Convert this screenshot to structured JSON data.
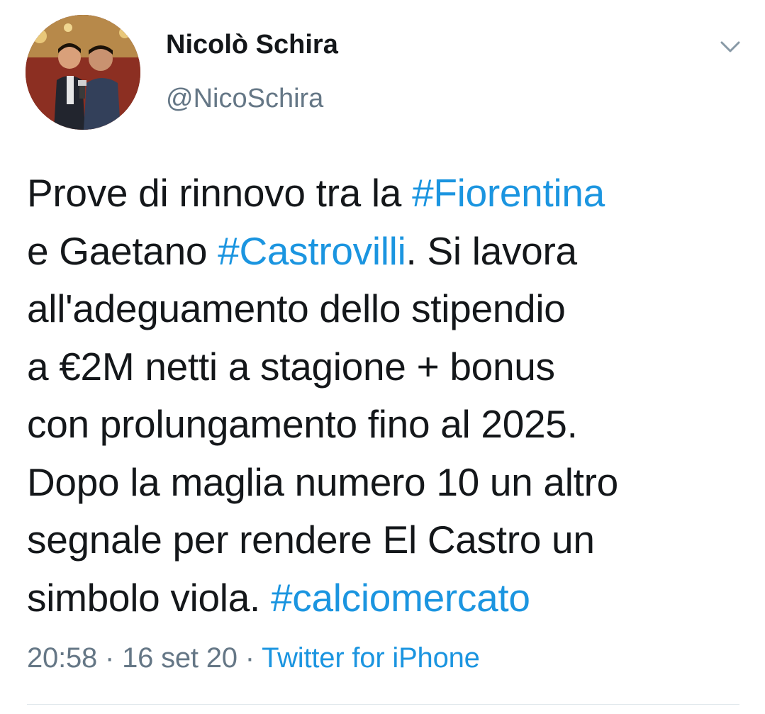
{
  "author": {
    "display_name": "Nicolò Schira",
    "handle": "@NicoSchira"
  },
  "tweet": {
    "lines": [
      [
        {
          "text": "Prove di rinnovo tra la "
        },
        {
          "text": "#Fiorentina",
          "hashtag": true
        }
      ],
      [
        {
          "text": "e Gaetano "
        },
        {
          "text": "#Castrovilli",
          "hashtag": true
        },
        {
          "text": ". Si lavora"
        }
      ],
      [
        {
          "text": "all'adeguamento dello stipendio"
        }
      ],
      [
        {
          "text": "a €2M netti a stagione + bonus"
        }
      ],
      [
        {
          "text": "con prolungamento fino al 2025."
        }
      ],
      [
        {
          "text": "Dopo la maglia numero 10 un altro"
        }
      ],
      [
        {
          "text": "segnale per rendere El Castro un"
        }
      ],
      [
        {
          "text": "simbolo viola. "
        },
        {
          "text": "#calciomercato",
          "hashtag": true
        }
      ]
    ]
  },
  "meta": {
    "time": "20:58",
    "separator": " · ",
    "date": "16 set 20",
    "source": "Twitter for iPhone"
  },
  "icons": {
    "caret": "chevron-down-icon",
    "avatar": "profile-photo"
  },
  "colors": {
    "text": "#14171a",
    "secondary": "#657786",
    "link": "#1b95e0",
    "divider": "#e1e8ed"
  }
}
